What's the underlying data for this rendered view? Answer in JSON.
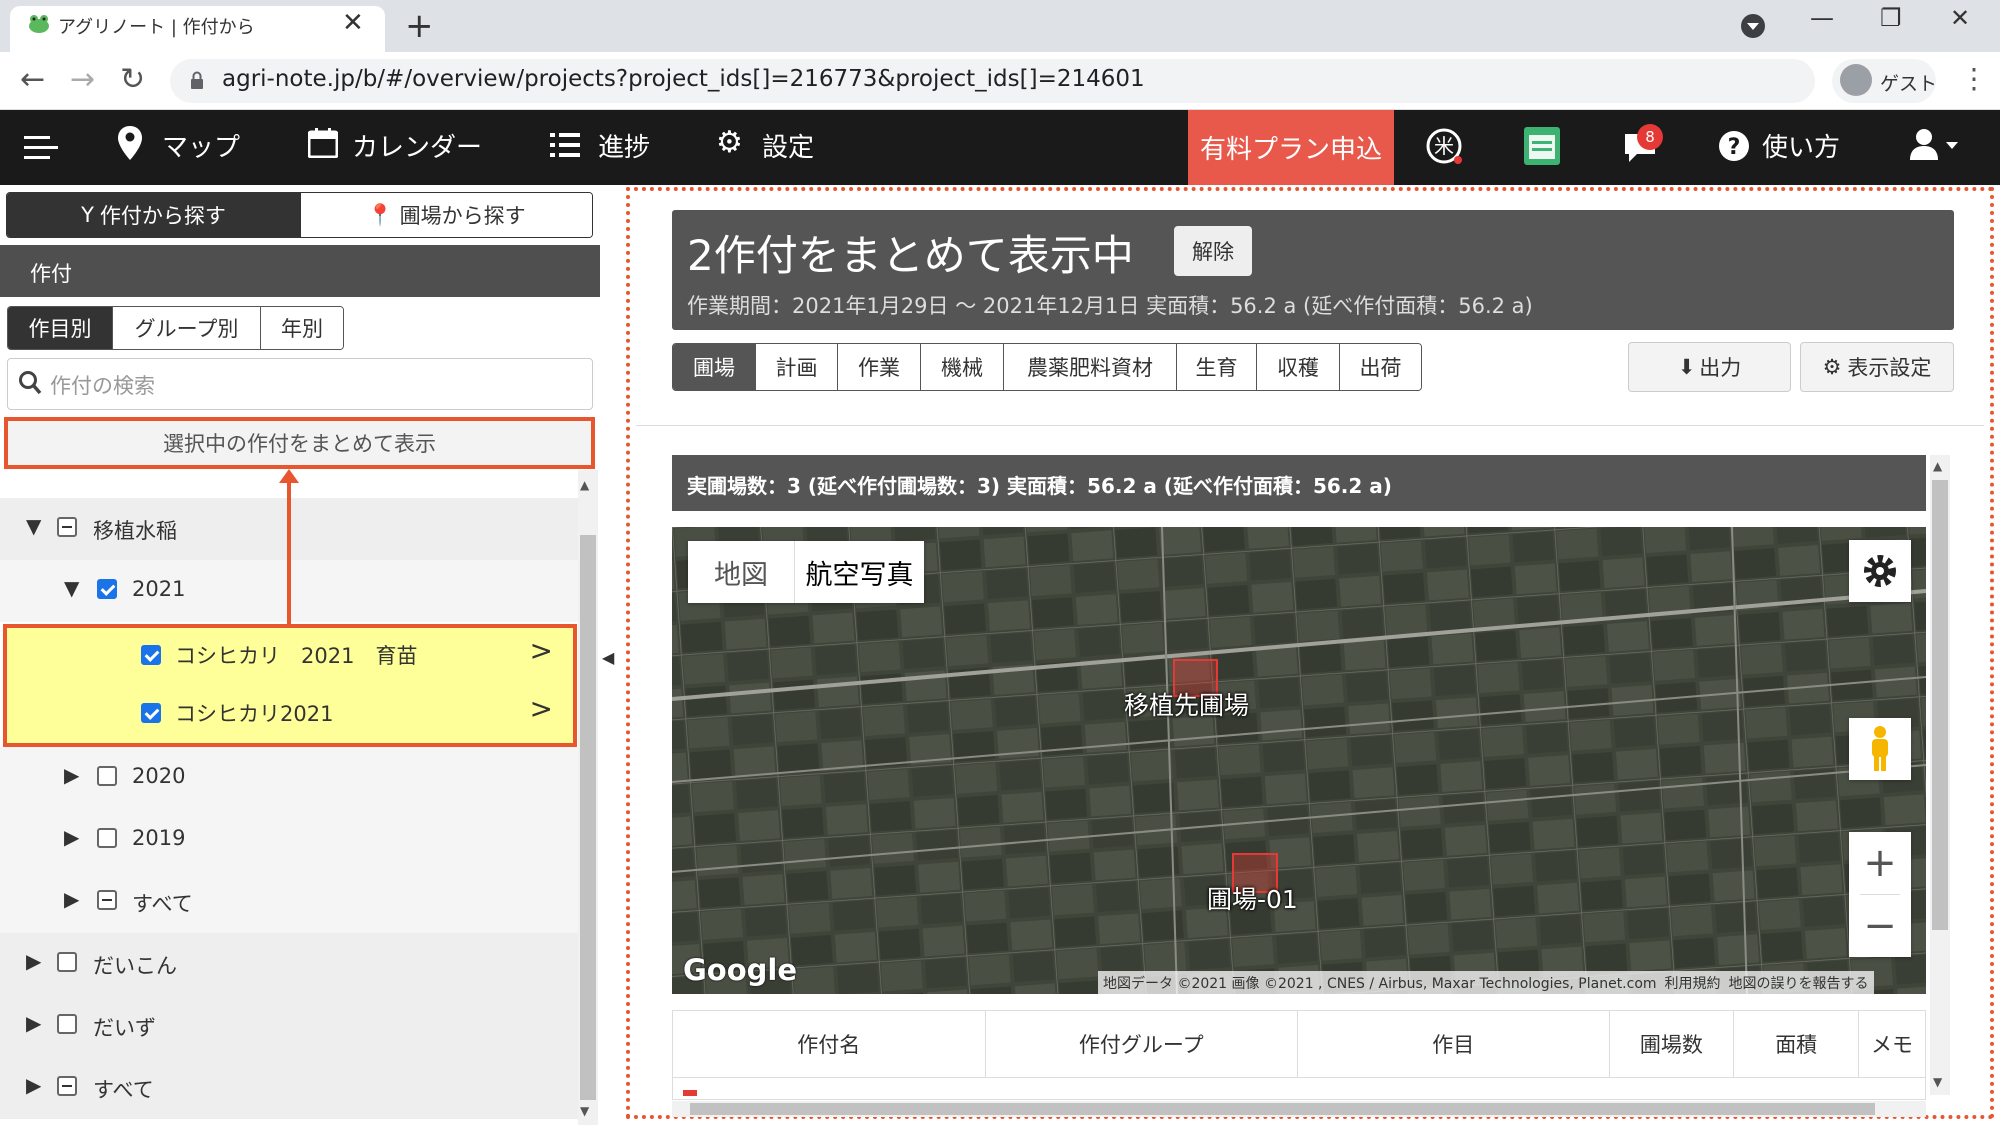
{
  "browser": {
    "tab_title": "アグリノート | 作付から",
    "tab_close": "✕",
    "new_tab": "+",
    "url": "agri-note.jp/b/#/overview/projects?project_ids[]=216773&project_ids[]=214601",
    "guest_label": "ゲスト",
    "win_min": "—",
    "win_restore": "❐",
    "win_close": "✕"
  },
  "nav": {
    "map": "マップ",
    "calendar": "カレンダー",
    "progress": "進捗",
    "settings": "設定",
    "plan": "有料プラン申込",
    "notification_count": "8",
    "help": "使い方"
  },
  "left": {
    "tab_by_crop": "作付から探す",
    "tab_by_field": "圃場から探す",
    "section_title": "作付",
    "category_tabs": [
      "作目別",
      "グループ別",
      "年別"
    ],
    "search_placeholder": "作付の検索",
    "show_selected_button": "選択中の作付をまとめて表示",
    "tree": [
      {
        "label": "移植水稲",
        "state": "partial",
        "expanded": true,
        "level": 0
      },
      {
        "label": "2021",
        "state": "checked",
        "expanded": true,
        "level": 1
      },
      {
        "label": "コシヒカリ　2021　育苗",
        "state": "checked",
        "level": 2,
        "highlight": true
      },
      {
        "label": "コシヒカリ2021",
        "state": "checked",
        "level": 2,
        "highlight": true
      },
      {
        "label": "2020",
        "state": "unchecked",
        "expanded": false,
        "level": 1
      },
      {
        "label": "2019",
        "state": "unchecked",
        "expanded": false,
        "level": 1
      },
      {
        "label": "すべて",
        "state": "partial",
        "expanded": false,
        "level": 1
      },
      {
        "label": "だいこん",
        "state": "unchecked",
        "expanded": false,
        "level": 0
      },
      {
        "label": "だいず",
        "state": "unchecked",
        "expanded": false,
        "level": 0
      },
      {
        "label": "すべて",
        "state": "partial",
        "expanded": false,
        "level": 0
      }
    ]
  },
  "summary": {
    "title": "2作付をまとめて表示中",
    "release_button": "解除",
    "period": "作業期間：2021年1月29日 〜 2021年12月1日  実面積：56.2 a (延べ作付面積：56.2 a)"
  },
  "view_tabs": [
    "圃場",
    "計画",
    "作業",
    "機械",
    "農薬肥料資材",
    "生育",
    "収穫",
    "出荷"
  ],
  "buttons": {
    "export": "出力",
    "display_settings": "表示設定"
  },
  "stats": "実圃場数：3 (延べ作付圃場数：3)  実面積：56.2 a (延べ作付面積：56.2 a)",
  "map": {
    "types": [
      "地図",
      "航空写真"
    ],
    "field_labels": [
      "移植先圃場",
      "圃場-01"
    ],
    "google_logo": "Google",
    "attribution": [
      "地図データ ©2021 画像 ©2021 , CNES / Airbus, Maxar Technologies, Planet.com",
      "利用規約",
      "地図の誤りを報告する"
    ],
    "zoom_in": "+",
    "zoom_out": "−"
  },
  "table": {
    "headers": [
      "作付名",
      "作付グループ",
      "作目",
      "圃場数",
      "面積",
      "メモ"
    ]
  },
  "colors": {
    "accent": "#e8562f",
    "plan_button": "#e8594b",
    "nav_bg": "#1a1a1a",
    "highlight_bg": "#ffff99",
    "checkbox": "#1a73e8"
  }
}
